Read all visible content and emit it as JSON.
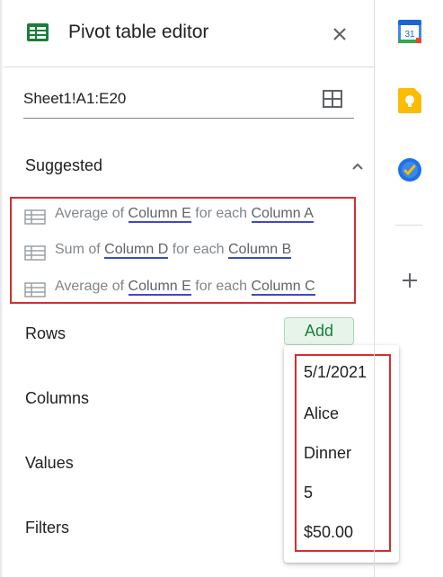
{
  "header": {
    "title": "Pivot table editor"
  },
  "range": {
    "value": "Sheet1!A1:E20"
  },
  "suggested": {
    "label": "Suggested",
    "items": [
      {
        "prefix": "Average of ",
        "col1": "Column E",
        "mid": " for each ",
        "col2": "Column A"
      },
      {
        "prefix": "Sum of ",
        "col1": "Column D",
        "mid": " for each ",
        "col2": "Column B"
      },
      {
        "prefix": "Average of ",
        "col1": "Column E",
        "mid": " for each ",
        "col2": "Column C"
      }
    ]
  },
  "sections": {
    "rows": "Rows",
    "columns": "Columns",
    "values": "Values",
    "filters": "Filters",
    "add_label": "Add"
  },
  "dropdown": {
    "options": [
      "5/1/2021",
      "Alice",
      "Dinner",
      "5",
      "$50.00"
    ]
  },
  "side_panel": {
    "calendar_day": "31",
    "icons": [
      "calendar-icon",
      "keep-icon",
      "tasks-icon",
      "plus-icon"
    ]
  },
  "colors": {
    "accent_green": "#188038",
    "highlight_red": "#d32f2f",
    "link_underline": "#3c4bc4"
  }
}
